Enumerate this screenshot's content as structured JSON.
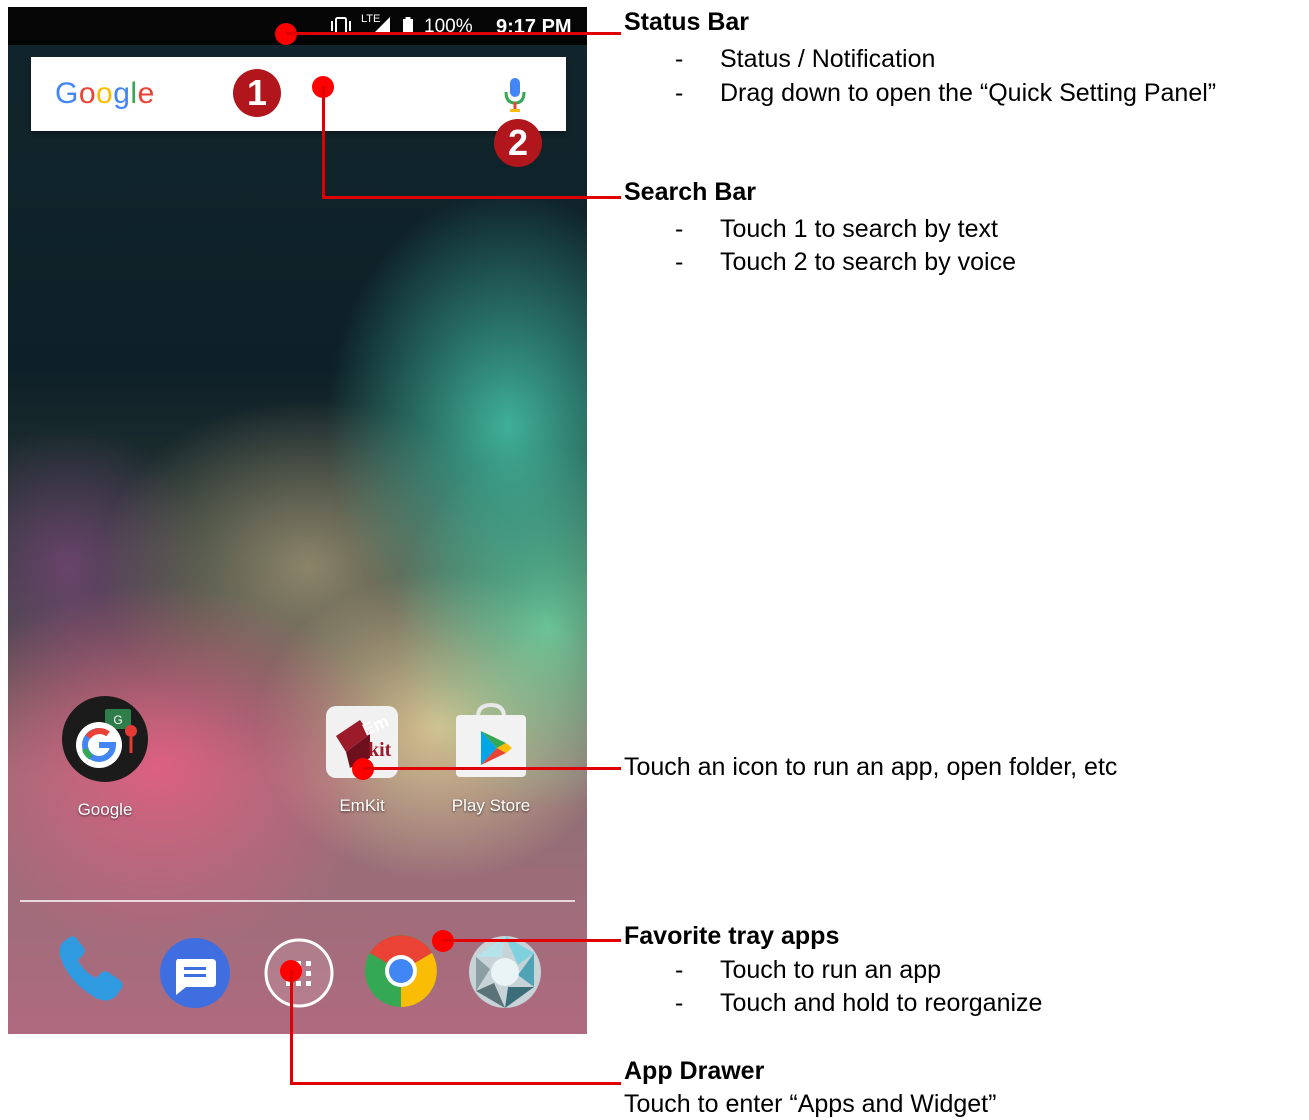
{
  "status_bar": {
    "network": "LTE",
    "battery": "100%",
    "time": "9:17 PM"
  },
  "search_bar": {
    "logo_text": "Google",
    "badge_1": "1",
    "badge_2": "2"
  },
  "home_apps": [
    {
      "label": "Google",
      "icon": "google-folder-icon"
    },
    {
      "label": "EmKit",
      "icon": "emkit-icon"
    },
    {
      "label": "Play Store",
      "icon": "play-store-icon"
    }
  ],
  "dock_apps": [
    "phone-icon",
    "messages-icon",
    "app-drawer-icon",
    "chrome-icon",
    "camera-icon"
  ],
  "callouts": {
    "status_bar": {
      "title": "Status Bar",
      "items": [
        "Status / Notification",
        "Drag down to open the “Quick Setting Panel”"
      ]
    },
    "search_bar": {
      "title": "Search Bar",
      "items": [
        "Touch 1 to search by text",
        "Touch 2 to search by voice"
      ]
    },
    "icon": {
      "text": "Touch an icon to run an app, open folder, etc"
    },
    "favorite_tray": {
      "title": "Favorite tray apps",
      "items": [
        "Touch to run an app",
        "Touch and hold to reorganize"
      ]
    },
    "app_drawer": {
      "title": "App Drawer",
      "text": "Touch to enter “Apps and Widget”"
    },
    "dash": "-"
  },
  "colors": {
    "callout_red": "#e00000",
    "badge_red": "#b1161c"
  }
}
